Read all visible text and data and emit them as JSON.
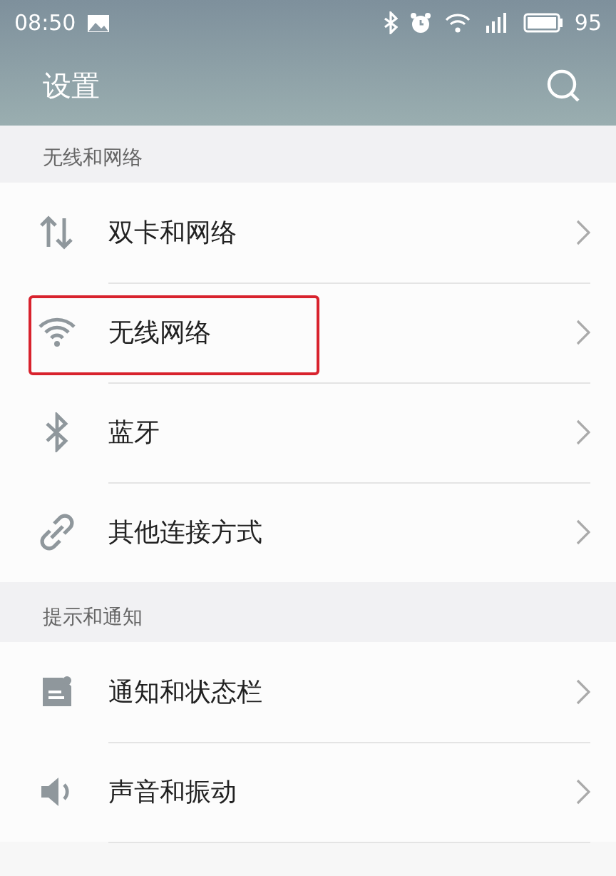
{
  "status_bar": {
    "time": "08:50",
    "battery": "95"
  },
  "header": {
    "title": "设置"
  },
  "sections": [
    {
      "title": "无线和网络",
      "items": [
        {
          "label": "双卡和网络",
          "highlighted": false
        },
        {
          "label": "无线网络",
          "highlighted": true
        },
        {
          "label": "蓝牙",
          "highlighted": false
        },
        {
          "label": "其他连接方式",
          "highlighted": false
        }
      ]
    },
    {
      "title": "提示和通知",
      "items": [
        {
          "label": "通知和状态栏",
          "highlighted": false
        },
        {
          "label": "声音和振动",
          "highlighted": false
        }
      ]
    }
  ]
}
